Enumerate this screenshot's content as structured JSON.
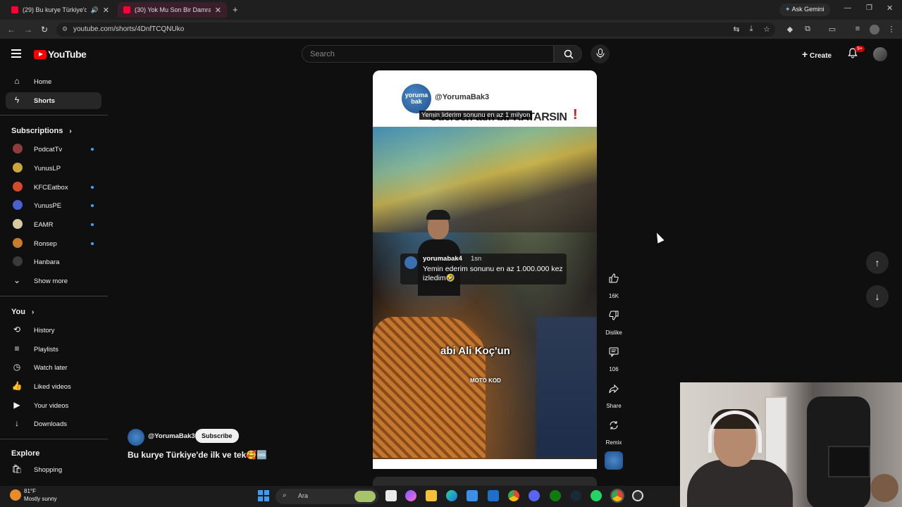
{
  "browser": {
    "tabs": [
      {
        "title": "(29) Bu kurye Türkiye'de ilk",
        "active": false
      },
      {
        "title": "(30) Yok Mu Son Bir Damran Ko",
        "active": true
      }
    ],
    "ask_gemini": "Ask Gemini",
    "url": "youtube.com/shorts/4DnfTCQNUko"
  },
  "header": {
    "logo_text": "YouTube",
    "search_placeholder": "Search",
    "create_label": "Create",
    "notification_count": "9+"
  },
  "sidebar": {
    "main": [
      {
        "label": "Home",
        "icon": "home-icon"
      },
      {
        "label": "Shorts",
        "icon": "shorts-icon",
        "active": true
      }
    ],
    "subscriptions_heading": "Subscriptions",
    "subscriptions": [
      {
        "label": "PodcatTv",
        "color": "#8e3d3d",
        "new": true
      },
      {
        "label": "YunusLP",
        "color": "#c9a53b",
        "new": false
      },
      {
        "label": "KFCEatbox",
        "color": "#d44b2c",
        "new": true
      },
      {
        "label": "YunusPE",
        "color": "#4a5fd0",
        "new": true
      },
      {
        "label": "EAMR",
        "color": "#d8c9a1",
        "new": true
      },
      {
        "label": "Ronsep",
        "color": "#c77c2b",
        "new": true
      },
      {
        "label": "Hanbara",
        "color": "#3a3a3a",
        "new": false
      }
    ],
    "show_more": "Show more",
    "you_heading": "You",
    "you_items": [
      {
        "label": "History",
        "icon": "history-icon"
      },
      {
        "label": "Playlists",
        "icon": "playlists-icon"
      },
      {
        "label": "Watch later",
        "icon": "watch-later-icon"
      },
      {
        "label": "Liked videos",
        "icon": "like-icon"
      },
      {
        "label": "Your videos",
        "icon": "your-videos-icon"
      },
      {
        "label": "Downloads",
        "icon": "download-icon"
      }
    ],
    "explore_heading": "Explore",
    "explore_items": [
      {
        "label": "Shopping",
        "icon": "shopping-icon"
      }
    ]
  },
  "short": {
    "logo_text": "yoruma bak",
    "channel_handle_overlay": "@YorumaBak3",
    "overlay_caption": "Yemin liderim sonunu en az 1 milyon",
    "big_caption": "Ödersen tam bir HATARSIN",
    "comment_user": "yorumabak4",
    "comment_time": "1sn",
    "comment_text": "Yemin ederim sonunu en az 1.000.000 kez izledim🤣",
    "video_text": "abi Ali Koç'un",
    "moto_text": "MOTO KOD"
  },
  "actions": {
    "likes": "16K",
    "dislike_label": "Dislike",
    "comments": "106",
    "share_label": "Share",
    "remix_label": "Remix"
  },
  "channel_info": {
    "handle": "@YorumaBak3",
    "subscribe_label": "Subscribe",
    "title": "Bu kurye Türkiye'de ilk ve tek🥰🆒"
  },
  "taskbar": {
    "weather_temp": "81°F",
    "weather_desc": "Mostly sunny",
    "search_label": "Ara"
  }
}
